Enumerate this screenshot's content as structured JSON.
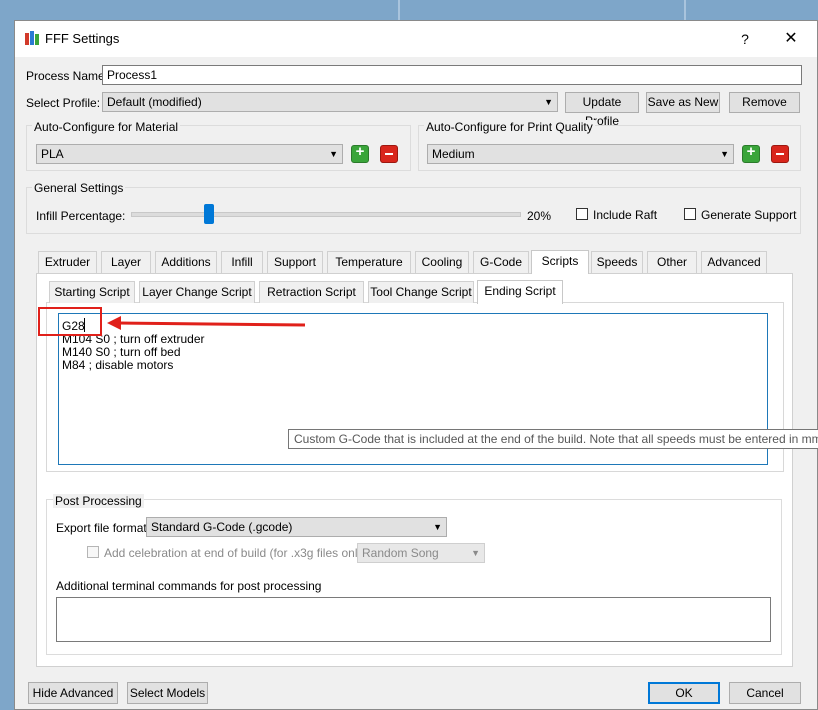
{
  "window": {
    "title": "FFF Settings",
    "help": "?",
    "close": "✕"
  },
  "process": {
    "label": "Process Name:",
    "value": "Process1"
  },
  "profile": {
    "label": "Select Profile:",
    "value": "Default (modified)",
    "buttons": {
      "update": "Update Profile",
      "save_as_new": "Save as New",
      "remove": "Remove"
    }
  },
  "material": {
    "title": "Auto-Configure for Material",
    "value": "PLA"
  },
  "quality": {
    "title": "Auto-Configure for Print Quality",
    "value": "Medium"
  },
  "general": {
    "title": "General Settings",
    "infill_label": "Infill Percentage:",
    "infill_value": "20%",
    "infill_fraction": 0.2,
    "raft_label": "Include Raft",
    "support_label": "Generate Support"
  },
  "tabs": [
    "Extruder",
    "Layer",
    "Additions",
    "Infill",
    "Support",
    "Temperature",
    "Cooling",
    "G-Code",
    "Scripts",
    "Speeds",
    "Other",
    "Advanced"
  ],
  "active_tab": "Scripts",
  "subtabs": [
    "Starting Script",
    "Layer Change Script",
    "Retraction Script",
    "Tool Change Script",
    "Ending Script"
  ],
  "active_subtab": "Ending Script",
  "script_lines": [
    "G28",
    "M104 S0 ; turn off extruder",
    "M140 S0 ; turn off bed",
    "M84 ; disable motors"
  ],
  "tooltip": "Custom G-Code that is included at the end of the build.  Note that all speeds must be entered in mm",
  "post": {
    "title": "Post Processing",
    "export_label": "Export file format",
    "export_value": "Standard G-Code (.gcode)",
    "celebration_label": "Add celebration at end of build (for .x3g files only)",
    "celebration_value": "Random Song",
    "terminal_label": "Additional terminal commands for post processing"
  },
  "footer": {
    "hide_advanced": "Hide Advanced",
    "select_models": "Select Models",
    "ok": "OK",
    "cancel": "Cancel"
  },
  "colors": {
    "accent": "#0078d7",
    "annotation": "#e0201a",
    "plus": "#3aa53a",
    "minus": "#d9261c"
  }
}
